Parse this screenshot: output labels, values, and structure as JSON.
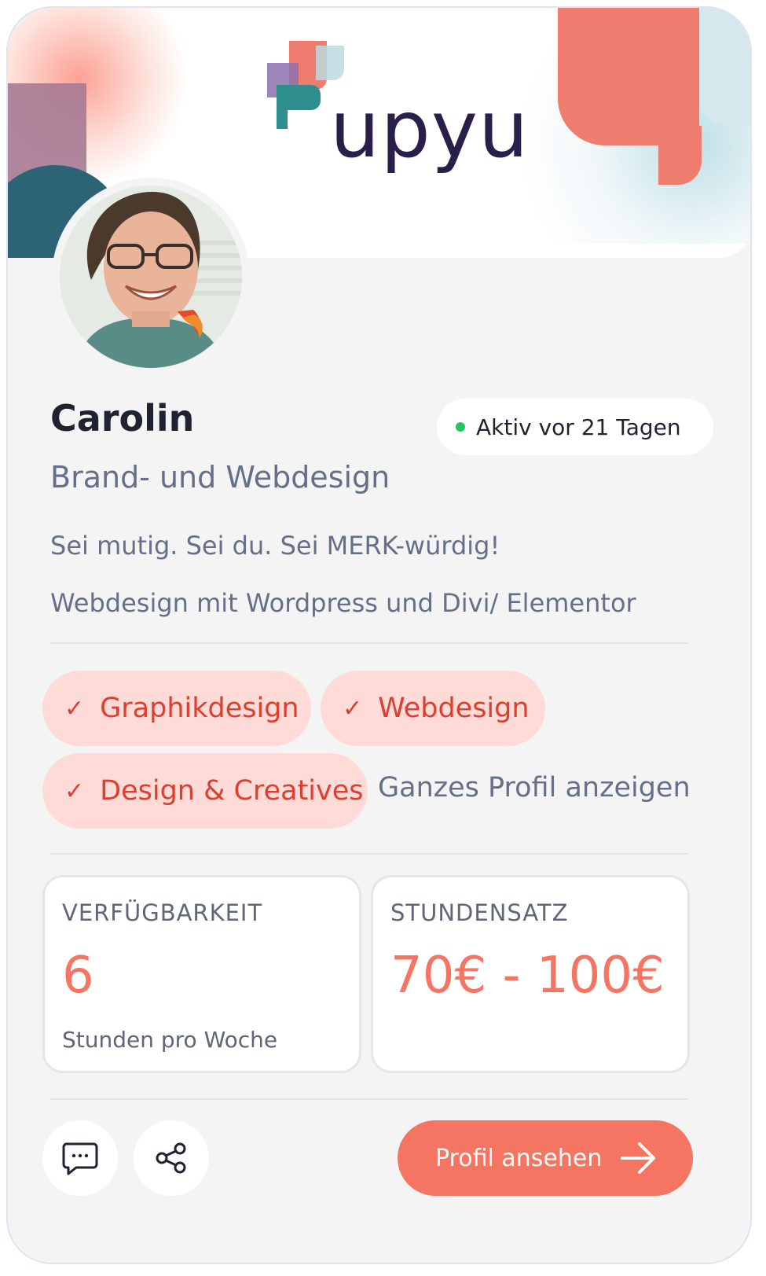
{
  "brand": {
    "logo_text": "upyu"
  },
  "profile": {
    "name": "Carolin",
    "title": "Brand- und Webdesign",
    "status": "Aktiv vor 21 Tagen",
    "bio_line1": "Sei mutig. Sei du. Sei MERK-würdig!",
    "bio_line2": "Webdesign mit Wordpress und Divi/ Elementor"
  },
  "tags": [
    "Graphikdesign",
    "Webdesign",
    "Design & Creatives"
  ],
  "full_profile_link": "Ganzes Profil anzeigen",
  "stats": {
    "availability": {
      "label": "VERFÜGBARKEIT",
      "value": "6",
      "unit": "Stunden pro Woche"
    },
    "rate": {
      "label": "STUNDENSATZ",
      "value": "70€ - 100€"
    }
  },
  "actions": {
    "cta_label": "Profil ansehen",
    "message_icon": "chat-bubble-icon",
    "share_icon": "share-icon"
  },
  "colors": {
    "accent": "#f57462",
    "tag_bg": "#fedbd7",
    "tag_text": "#dc3e30",
    "status_dot": "#22c55e",
    "logo_text": "#2a1e4a"
  }
}
